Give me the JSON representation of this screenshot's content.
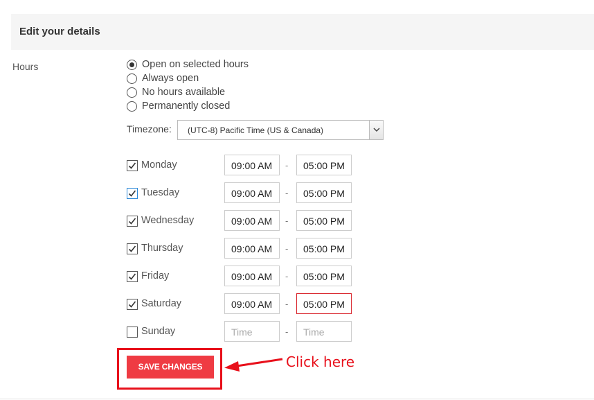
{
  "header": {
    "title": "Edit your details"
  },
  "hours": {
    "label": "Hours",
    "options": [
      {
        "label": "Open on selected hours",
        "checked": true
      },
      {
        "label": "Always open",
        "checked": false
      },
      {
        "label": "No hours available",
        "checked": false
      },
      {
        "label": "Permanently closed",
        "checked": false
      }
    ]
  },
  "timezone": {
    "label": "Timezone:",
    "selected": "(UTC-8) Pacific Time (US & Canada)"
  },
  "days": [
    {
      "name": "Monday",
      "checked": true,
      "start": "09:00 AM",
      "end": "05:00 PM"
    },
    {
      "name": "Tuesday",
      "checked": true,
      "start": "09:00 AM",
      "end": "05:00 PM"
    },
    {
      "name": "Wednesday",
      "checked": true,
      "start": "09:00 AM",
      "end": "05:00 PM"
    },
    {
      "name": "Thursday",
      "checked": true,
      "start": "09:00 AM",
      "end": "05:00 PM"
    },
    {
      "name": "Friday",
      "checked": true,
      "start": "09:00 AM",
      "end": "05:00 PM"
    },
    {
      "name": "Saturday",
      "checked": true,
      "start": "09:00 AM",
      "end": "05:00 PM"
    },
    {
      "name": "Sunday",
      "checked": false,
      "start": "",
      "end": "",
      "placeholder": "Time"
    }
  ],
  "separator": "-",
  "save_button": {
    "label": "SAVE CHANGES"
  },
  "annotation": {
    "text": "Click here"
  },
  "colors": {
    "accent": "#ef3b43",
    "annotation": "#e8101b",
    "focus": "#2b88d8"
  }
}
